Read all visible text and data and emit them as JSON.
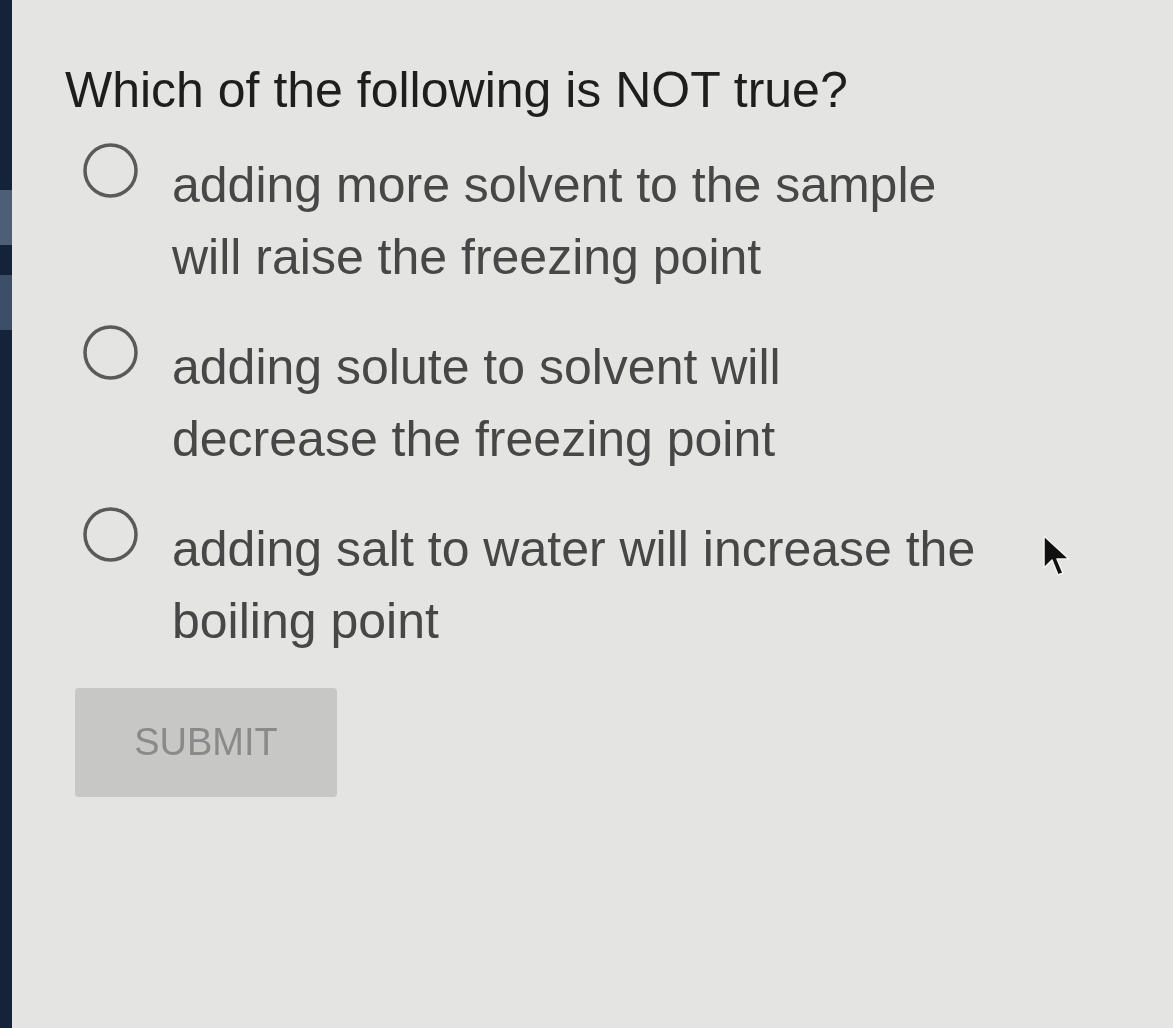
{
  "question": {
    "text": "Which of the following is NOT true?"
  },
  "options": [
    {
      "label": "adding more solvent to the sample\nwill raise the freezing point",
      "selected": false
    },
    {
      "label": "adding solute to solvent will\ndecrease the freezing point",
      "selected": false
    },
    {
      "label": "adding salt to water will increase the\nboiling point",
      "selected": false
    }
  ],
  "submit_button": {
    "label": "SUBMIT",
    "disabled": true
  }
}
